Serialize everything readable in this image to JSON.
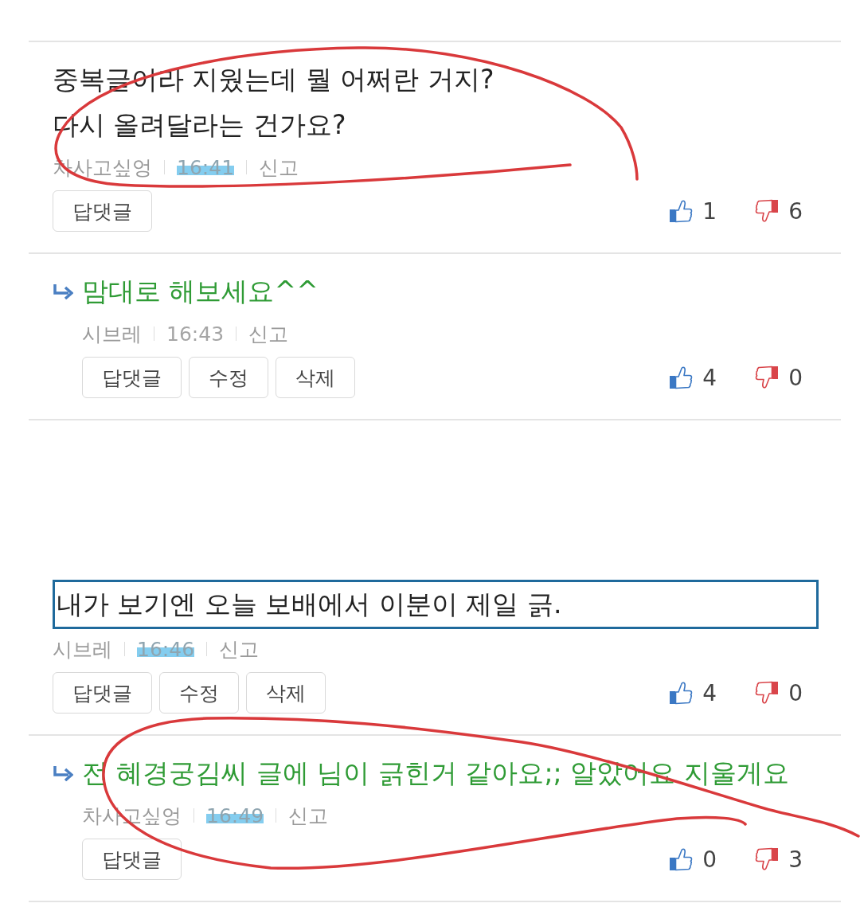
{
  "comments": [
    {
      "kind": "comment",
      "text": "중복글이라 지웠는데 뭘 어쩌란 거지?\n다시 올려달라는 건가요?",
      "framed": false,
      "circled": true,
      "author": "차사고싶엉",
      "time": "16:41",
      "time_highlighted": true,
      "report": "신고",
      "buttons": [
        "답댓글"
      ],
      "likes": "1",
      "dislikes": "6"
    },
    {
      "kind": "reply",
      "text": "맘대로 해보세요^^",
      "framed": false,
      "circled": false,
      "author": "시브레",
      "time": "16:43",
      "time_highlighted": false,
      "report": "신고",
      "buttons": [
        "답댓글",
        "수정",
        "삭제"
      ],
      "likes": "4",
      "dislikes": "0"
    },
    {
      "kind": "comment",
      "text": "내가 보기엔 오늘 보배에서 이분이 제일 긁.",
      "framed": true,
      "circled": false,
      "author": "시브레",
      "time": "16:46",
      "time_highlighted": true,
      "report": "신고",
      "buttons": [
        "답댓글",
        "수정",
        "삭제"
      ],
      "likes": "4",
      "dislikes": "0"
    },
    {
      "kind": "reply",
      "text": "전 혜경궁김씨 글에 님이 긁힌거 같아요;; 알았어요 지울게요",
      "framed": false,
      "circled": true,
      "author": "차사고싶엉",
      "time": "16:49",
      "time_highlighted": true,
      "report": "신고",
      "buttons": [
        "답댓글"
      ],
      "likes": "0",
      "dislikes": "3"
    }
  ]
}
